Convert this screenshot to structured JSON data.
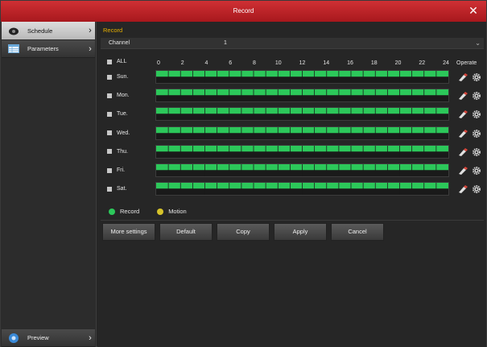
{
  "window": {
    "title": "Record",
    "close_glyph": "✕"
  },
  "sidebar": {
    "items": [
      {
        "label": "Schedule",
        "icon": "camera-icon",
        "active": true
      },
      {
        "label": "Parameters",
        "icon": "parameters-icon",
        "active": false
      }
    ],
    "preview": {
      "label": "Preview",
      "icon": "preview-icon"
    }
  },
  "main": {
    "section_title": "Record",
    "channel": {
      "label": "Channel",
      "value": "1"
    },
    "grid": {
      "all_label": "ALL",
      "hour_ticks": [
        "0",
        "2",
        "4",
        "6",
        "8",
        "10",
        "12",
        "14",
        "16",
        "18",
        "20",
        "22",
        "24"
      ],
      "operate_label": "Operate",
      "days": [
        {
          "label": "Sun.",
          "record_hours": [
            0,
            24
          ]
        },
        {
          "label": "Mon.",
          "record_hours": [
            0,
            24
          ]
        },
        {
          "label": "Tue.",
          "record_hours": [
            0,
            24
          ]
        },
        {
          "label": "Wed.",
          "record_hours": [
            0,
            24
          ]
        },
        {
          "label": "Thu.",
          "record_hours": [
            0,
            24
          ]
        },
        {
          "label": "Fri.",
          "record_hours": [
            0,
            24
          ]
        },
        {
          "label": "Sat.",
          "record_hours": [
            0,
            24
          ]
        }
      ]
    },
    "legend": [
      {
        "label": "Record",
        "color": "#2cc85a"
      },
      {
        "label": "Motion",
        "color": "#d6c32a"
      }
    ],
    "buttons": [
      "More settings",
      "Default",
      "Copy",
      "Apply",
      "Cancel"
    ]
  }
}
